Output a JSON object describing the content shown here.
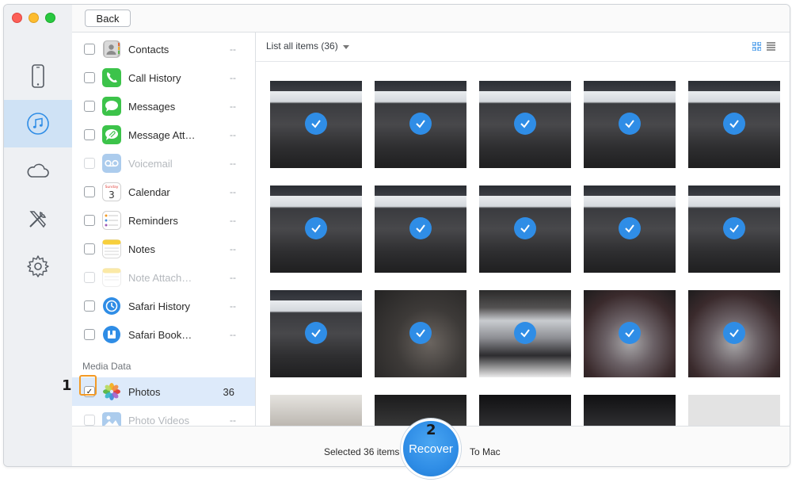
{
  "toolbar": {
    "back_label": "Back"
  },
  "categories": [
    {
      "label": "Contacts",
      "count": "--",
      "icon": "contacts-icon",
      "enabled": true
    },
    {
      "label": "Call History",
      "count": "--",
      "icon": "phone-icon",
      "enabled": true
    },
    {
      "label": "Messages",
      "count": "--",
      "icon": "messages-icon",
      "enabled": true
    },
    {
      "label": "Message Att…",
      "count": "--",
      "icon": "message-attachment-icon",
      "enabled": true
    },
    {
      "label": "Voicemail",
      "count": "--",
      "icon": "voicemail-icon",
      "enabled": false
    },
    {
      "label": "Calendar",
      "count": "--",
      "icon": "calendar-icon",
      "enabled": true
    },
    {
      "label": "Reminders",
      "count": "--",
      "icon": "reminders-icon",
      "enabled": true
    },
    {
      "label": "Notes",
      "count": "--",
      "icon": "notes-icon",
      "enabled": true
    },
    {
      "label": "Note Attach…",
      "count": "--",
      "icon": "note-attachment-icon",
      "enabled": false
    },
    {
      "label": "Safari History",
      "count": "--",
      "icon": "safari-history-icon",
      "enabled": true
    },
    {
      "label": "Safari Book…",
      "count": "--",
      "icon": "safari-bookmark-icon",
      "enabled": true
    }
  ],
  "calendar_day": "3",
  "calendar_weekday": "Sunday",
  "media_section": {
    "title": "Media Data"
  },
  "media": [
    {
      "label": "Photos",
      "count": "36",
      "icon": "photos-icon",
      "checked": true,
      "selected": true
    },
    {
      "label": "Photo Videos",
      "count": "--",
      "icon": "photo-videos-icon",
      "checked": false,
      "enabled": false
    }
  ],
  "content": {
    "list_label": "List all items (36)",
    "view_modes": [
      "grid-view-icon",
      "list-view-icon"
    ]
  },
  "photos": {
    "total_visible_rows": 4,
    "checked_all": true
  },
  "bottom": {
    "selected_text": "Selected 36 items",
    "recover_label": "Recover",
    "tomac_text": "To Mac"
  },
  "annotations": {
    "step1": "1",
    "step2": "2"
  },
  "colors": {
    "accent": "#2f8de6",
    "highlight": "#f39a25",
    "selected_row": "#ddeafa",
    "nav_active": "#cfe2f5"
  }
}
